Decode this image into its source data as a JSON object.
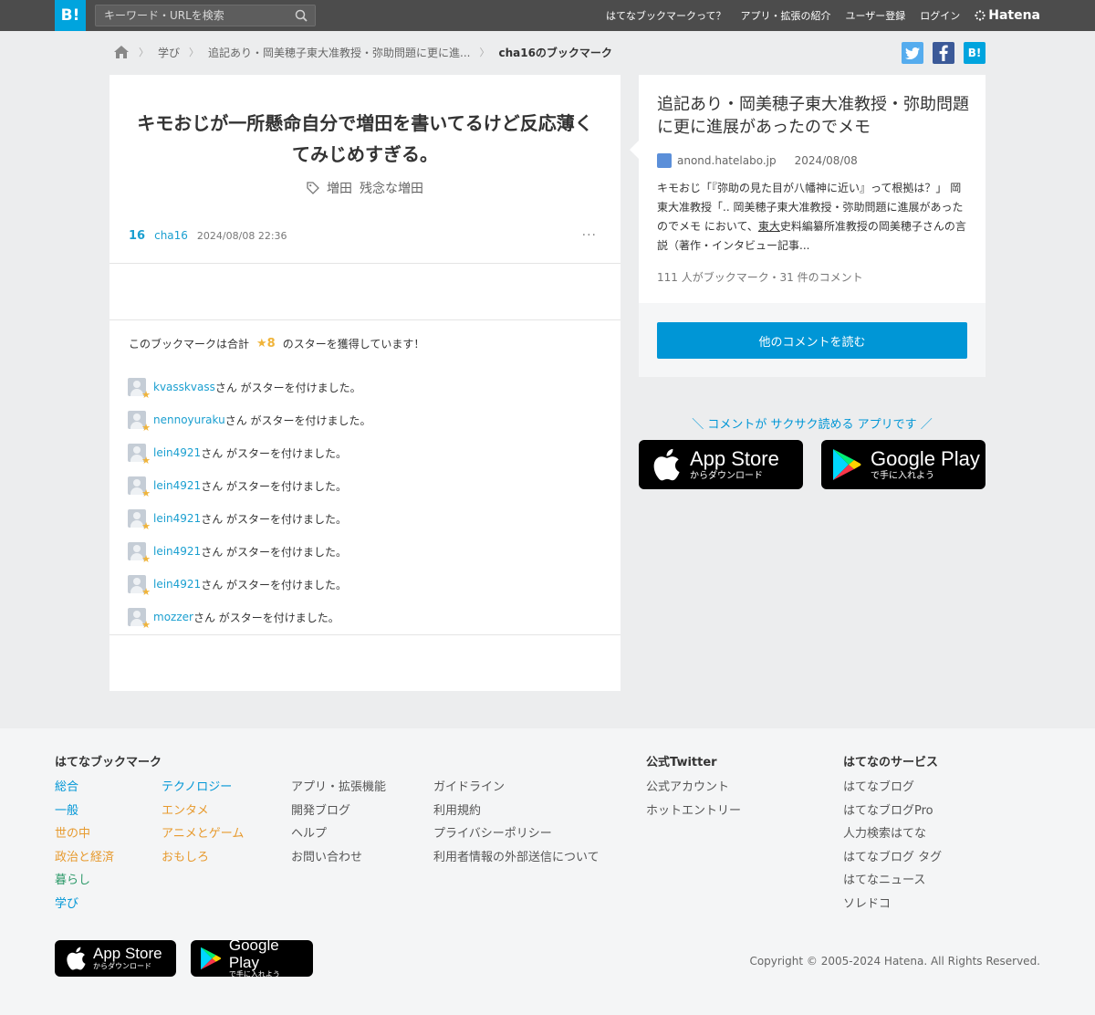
{
  "header": {
    "logo": "B!",
    "search_placeholder": "キーワード・URLを検索",
    "nav": [
      "はてなブックマークって？",
      "アプリ・拡張の紹介",
      "ユーザー登録",
      "ログイン"
    ],
    "brand": "Hatena"
  },
  "breadcrumb": {
    "items": [
      "学び",
      "追記あり・岡美穂子東大准教授・弥助問題に更に進...",
      "cha16のブックマーク"
    ]
  },
  "share": {
    "hatena": "B!"
  },
  "bookmark": {
    "comment": "キモおじが一所懸命自分で増田を書いてるけど反応薄くてみじめすぎる。",
    "tags": [
      "増田",
      "残念な増田"
    ],
    "count": "16",
    "user": "cha16",
    "time": "2024/08/08 22:36",
    "more": "···"
  },
  "stars": {
    "summary_prefix": "このブックマークは合計",
    "summary_count": "★8",
    "summary_suffix": "のスターを獲得しています！",
    "suffix": "さん がスターを付けました。",
    "list": [
      {
        "user": "kvasskvass"
      },
      {
        "user": "nennoyuraku"
      },
      {
        "user": "lein4921"
      },
      {
        "user": "lein4921"
      },
      {
        "user": "lein4921"
      },
      {
        "user": "lein4921"
      },
      {
        "user": "lein4921"
      },
      {
        "user": "mozzer"
      }
    ]
  },
  "entry": {
    "title": "追記あり・岡美穂子東大准教授・弥助問題に更に進展があったのでメモ",
    "domain": "anond.hatelabo.jp",
    "date": "2024/08/08",
    "summary_a": "キモおじ「『弥助の見た目が八幡神に近い』って根拠は？」 岡東大准教授「.. 岡美穂子東大准教授・弥助問題に進展があったのでメモ において、",
    "summary_ul": "東大",
    "summary_b": "史料編纂所准教授の岡美穂子さんの言説（著作・インタビュー記事...",
    "stats": "111 人がブックマーク・31 件のコメント",
    "read_button": "他のコメントを読む"
  },
  "promo": {
    "tagline": "＼ コメントが サクサク読める アプリです ／",
    "app_store_big": "App Store",
    "app_store_small": "からダウンロード",
    "google_play_big": "Google Play",
    "google_play_small": "で手に入れよう"
  },
  "footer": {
    "bookmark_heading": "はてなブックマーク",
    "categories_a": [
      {
        "label": "総合",
        "color": "#0096d6"
      },
      {
        "label": "一般",
        "color": "#0096d6"
      },
      {
        "label": "世の中",
        "color": "#e79a2e"
      },
      {
        "label": "政治と経済",
        "color": "#e79a2e"
      },
      {
        "label": "暮らし",
        "color": "#2d9a6a"
      },
      {
        "label": "学び",
        "color": "#0096d6"
      }
    ],
    "categories_b": [
      "テクノロジー",
      "エンタメ",
      "アニメとゲーム",
      "おもしろ"
    ],
    "links_a": [
      "アプリ・拡張機能",
      "開発ブログ",
      "ヘルプ",
      "お問い合わせ"
    ],
    "links_b": [
      "ガイドライン",
      "利用規約",
      "プライバシーポリシー",
      "利用者情報の外部送信について"
    ],
    "twitter_heading": "公式Twitter",
    "twitter_links": [
      "公式アカウント",
      "ホットエントリー"
    ],
    "services_heading": "はてなのサービス",
    "services": [
      "はてなブログ",
      "はてなブログPro",
      "人力検索はてな",
      "はてなブログ タグ",
      "はてなニュース",
      "ソレドコ"
    ],
    "copyright": "Copyright © 2005-2024 Hatena. All Rights Reserved."
  }
}
